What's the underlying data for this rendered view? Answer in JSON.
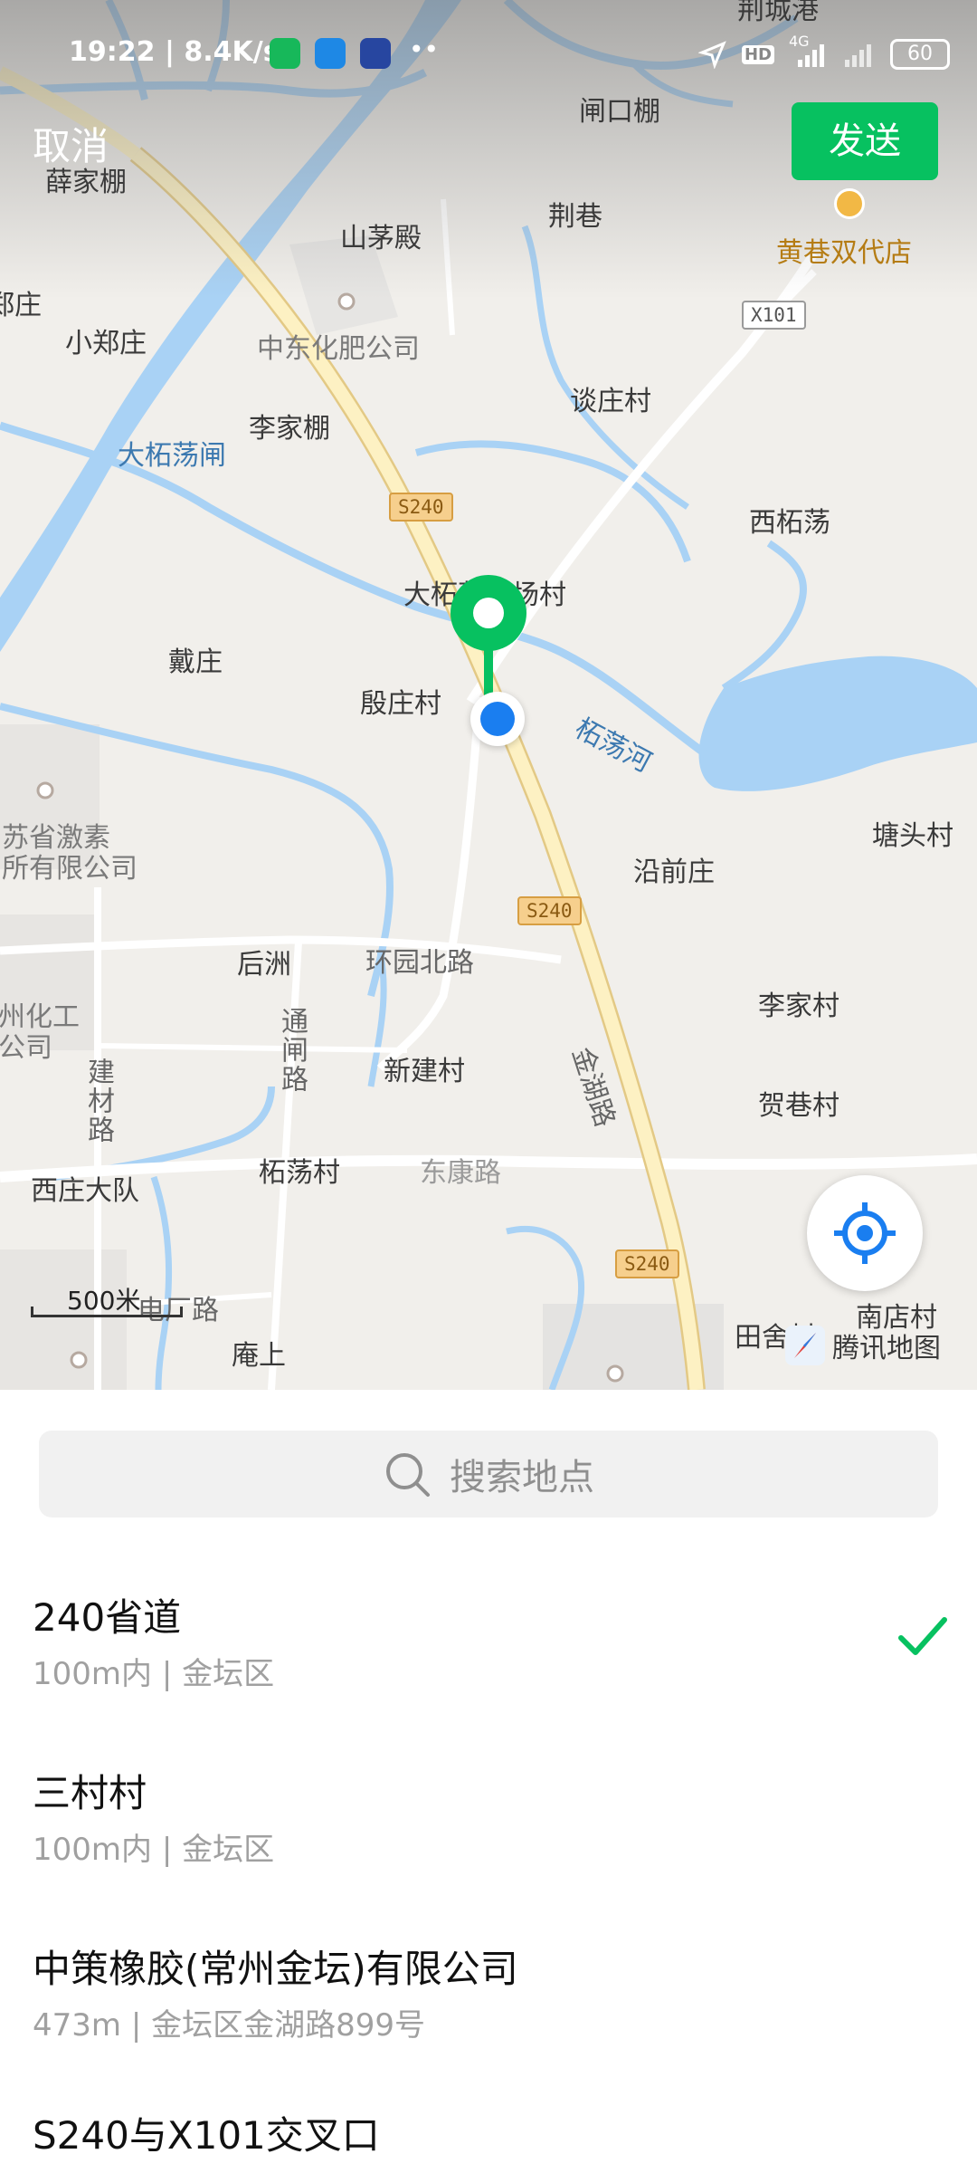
{
  "status_bar": {
    "time_speed": "19:22 | 8.4K/s",
    "more_dots": "••",
    "hd": "HD",
    "network": "4G",
    "battery": "60"
  },
  "header": {
    "cancel_label": "取消",
    "send_label": "发送"
  },
  "map": {
    "labels": {
      "top_cut": "荆城港",
      "zhakoupeng": "闸口棚",
      "xuejiapeng": "薛家棚",
      "jingxiang": "荆巷",
      "shanmaodian": "山茅殿",
      "huangxiang": "黄巷双代店",
      "zhengzhuang_left": "郑庄",
      "xiaozhengzhuang": "小郑庄",
      "zhongdong": "中东化肥公司",
      "tanzhuangcun": "谈庄村",
      "lijiapeng": "李家棚",
      "dazhedangzha": "大柘荡闸",
      "xizhedang": "西柘荡",
      "yuchangcun": "大柘荡渔场村",
      "daizhuang": "戴庄",
      "yinzhuangcun": "殷庄村",
      "zhedanghe": "柘荡河",
      "tangtoucun": "塘头村",
      "jisu_1": "苏省激素",
      "jisu_2": "所有限公司",
      "yanqianzhuang": "沿前庄",
      "houzhou": "后洲",
      "huanyuanbeilu": "环园北路",
      "lijiacun": "李家村",
      "huagong_1": "州化工",
      "huagong_2": "公司",
      "tongzhalu": "通闸路",
      "jiancailu": "建材路",
      "xinjiancun": "新建村",
      "jinhulu": "金湖路",
      "hexiangcun": "贺巷村",
      "xizhuangdadui": "西庄大队",
      "zhedangcun": "柘荡村",
      "dongkanglu": "东康路",
      "dianchanglu": "电厂路",
      "anshang": "庵上",
      "tiansheli": "田舍村",
      "nandiancun": "南店村"
    },
    "shields": {
      "s240_a": "S240",
      "s240_b": "S240",
      "s240_c": "S240",
      "x101": "X101"
    },
    "scale_label": "500米",
    "brand_label": "腾讯地图"
  },
  "search": {
    "placeholder": "搜索地点"
  },
  "results": [
    {
      "name": "240省道",
      "detail": "100m内 | 金坛区",
      "selected": true
    },
    {
      "name": "三村村",
      "detail": "100m内 | 金坛区",
      "selected": false
    },
    {
      "name": "中策橡胶(常州金坛)有限公司",
      "detail": "473m | 金坛区金湖路899号",
      "selected": false
    },
    {
      "name": "S240与X101交叉口",
      "detail": "",
      "selected": false
    }
  ],
  "colors": {
    "accent_green": "#07c160",
    "water": "#a9d2f5",
    "road_yellow": "#fdf1c3",
    "location_blue": "#1a7ef0"
  }
}
